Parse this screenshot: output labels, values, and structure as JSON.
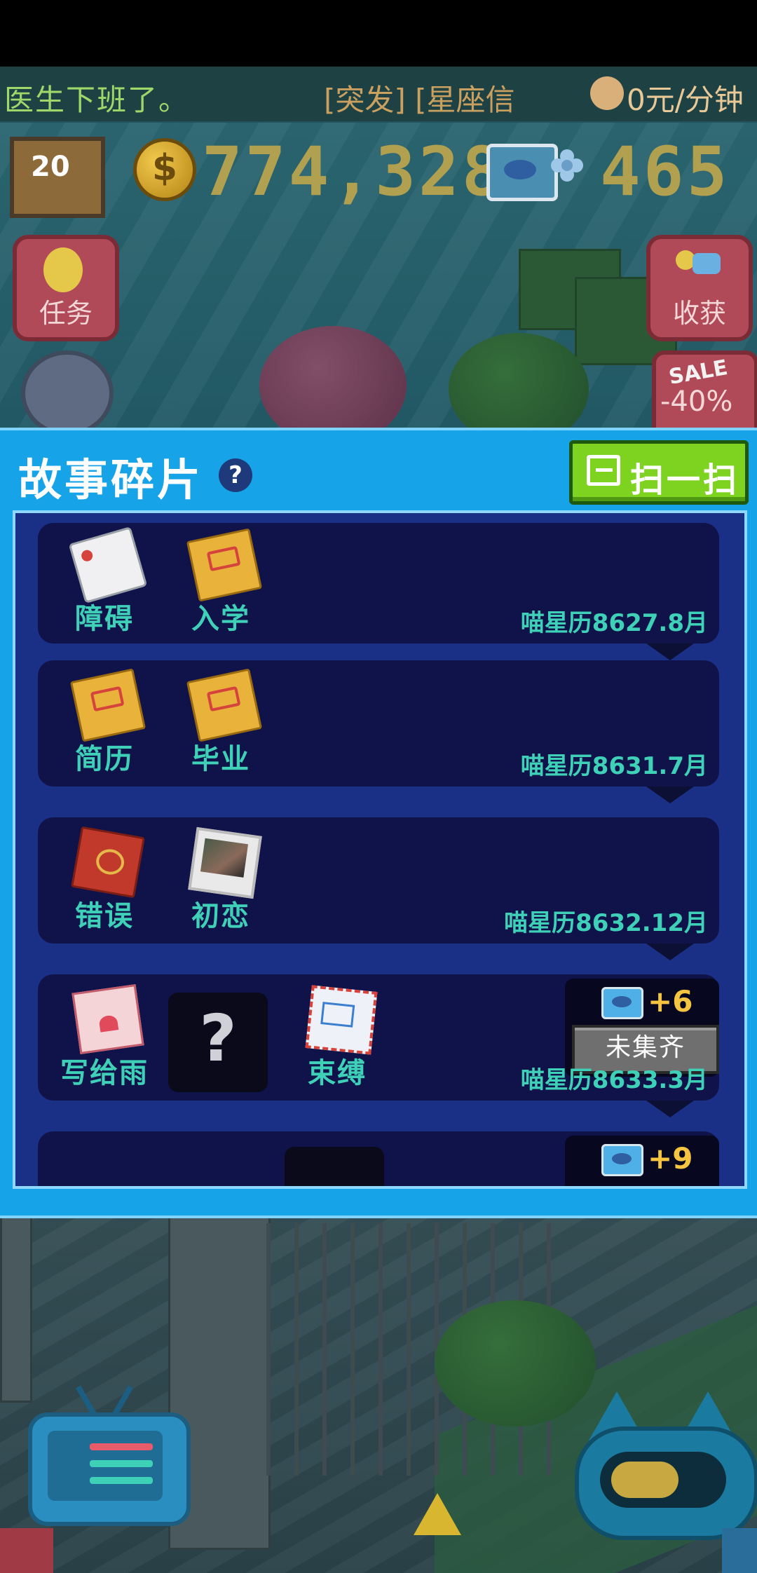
{
  "ticker": {
    "left": "医生下班了。",
    "middle": "[突发] [星座信",
    "right": "0元/分钟"
  },
  "hud": {
    "level": "20",
    "money": "774,328",
    "gems": "465",
    "task_label": "任务",
    "harvest_label": "收获",
    "sale_text": "SALE",
    "sale_pct": "-40%"
  },
  "modal": {
    "title": "故事碎片",
    "help_glyph": "?",
    "scan_label": "扫一扫"
  },
  "rows": [
    {
      "items": [
        {
          "label": "障碍",
          "art": "card"
        },
        {
          "label": "入学",
          "art": "envelope"
        }
      ],
      "date": "喵星历8627.8月"
    },
    {
      "items": [
        {
          "label": "简历",
          "art": "envelope"
        },
        {
          "label": "毕业",
          "art": "envelope"
        }
      ],
      "date": "喵星历8631.7月"
    },
    {
      "items": [
        {
          "label": "错误",
          "art": "redbook"
        },
        {
          "label": "初恋",
          "art": "photo"
        }
      ],
      "date": "喵星历8632.12月"
    },
    {
      "items": [
        {
          "label": "写给雨",
          "art": "letter"
        },
        {
          "label": "?",
          "art": "unknown"
        },
        {
          "label": "束缚",
          "art": "mail"
        }
      ],
      "reward": "+6",
      "status": "未集齐",
      "date": "喵星历8633.3月"
    },
    {
      "reward": "+9"
    }
  ],
  "colors": {
    "modal_bg": "#17a3e8",
    "panel_bg": "#1a2f86",
    "row_bg": "#10134a",
    "label_teal": "#3fd0b8",
    "scan_green": "#7ed321",
    "reward_gold": "#f5c542"
  },
  "icons": [
    "piggy-bank-icon",
    "coin-icon",
    "fish-tv-icon",
    "lightbulb-icon",
    "harvest-icon",
    "help-icon",
    "scan-icon",
    "tv-menu-icon",
    "cat-icon"
  ]
}
